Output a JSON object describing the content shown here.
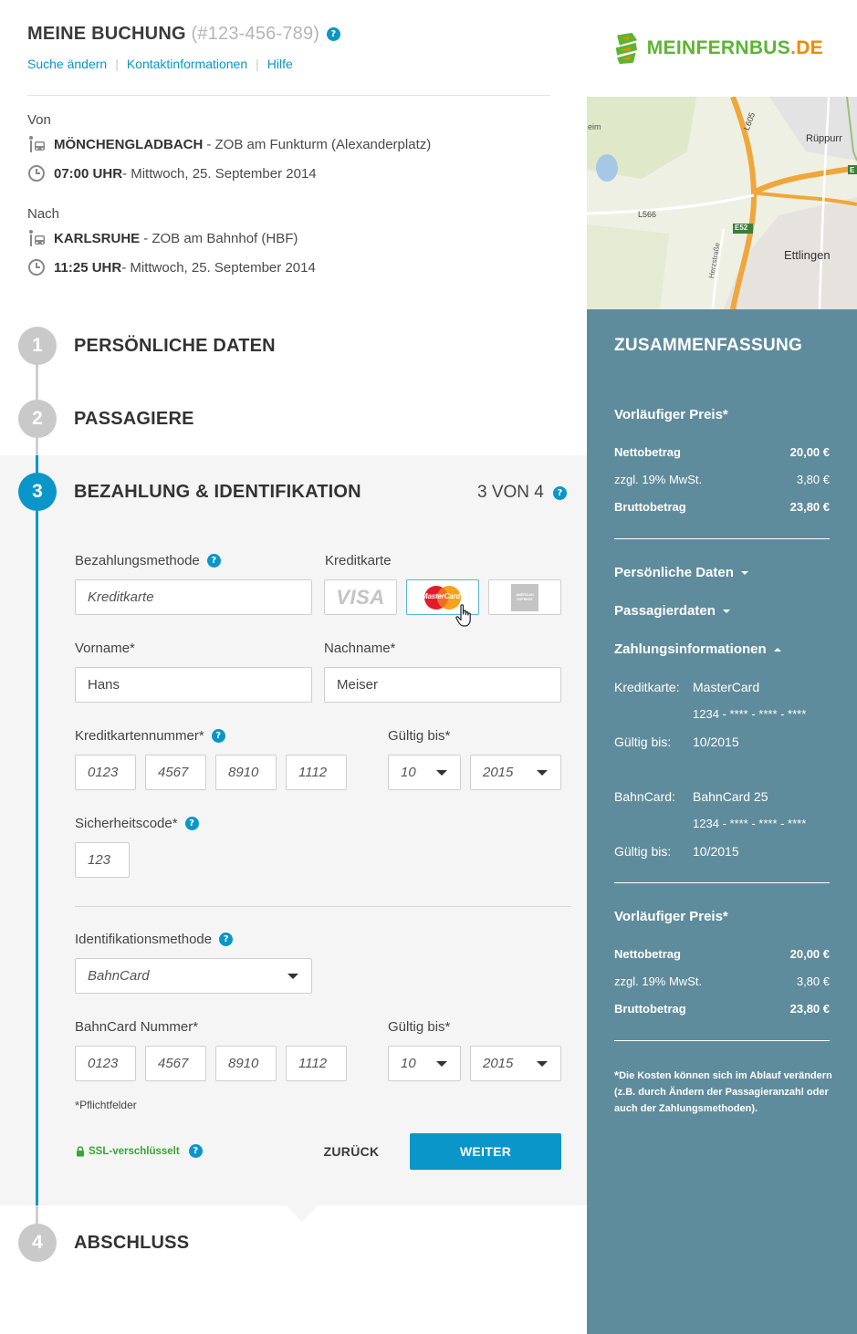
{
  "header": {
    "title": "MEINE BUCHUNG",
    "booking_number": "(#123-456-789)",
    "help_icon": "question-icon",
    "links": [
      "Suche ändern",
      "Kontaktinformationen",
      "Hilfe"
    ]
  },
  "logo": {
    "text_main": "MEINFERNBUS",
    "text_tld": ".DE",
    "colors": {
      "green": "#5cb531",
      "orange": "#f08a00"
    }
  },
  "route": {
    "from": {
      "label": "Von",
      "city": "MÖNCHENGLADBACH",
      "station": "- ZOB am Funkturm (Alexanderplatz)",
      "time": "07:00 UHR",
      "date": "- Mittwoch, 25. September 2014"
    },
    "to": {
      "label": "Nach",
      "city": "KARLSRUHE",
      "station": "- ZOB am Bahnhof (HBF)",
      "time": "11:25 UHR",
      "date": "- Mittwoch, 25. September 2014"
    }
  },
  "steps": [
    {
      "number": "1",
      "title": "PERSÖNLICHE DATEN"
    },
    {
      "number": "2",
      "title": "PASSAGIERE"
    },
    {
      "number": "3",
      "title": "BEZAHLUNG & IDENTIFIKATION",
      "progress": "3 VON 4"
    },
    {
      "number": "4",
      "title": "ABSCHLUSS"
    }
  ],
  "payment": {
    "method_label": "Bezahlungsmethode",
    "method_value": "Kreditkarte",
    "card_label": "Kreditkarte",
    "cards": [
      "VISA",
      "MasterCard",
      "AMERICAN EXPRESS"
    ],
    "selected_card": "MasterCard",
    "first_name_label": "Vorname*",
    "first_name": "Hans",
    "last_name_label": "Nachname*",
    "last_name": "Meiser",
    "cc_number_label": "Kreditkartennummer*",
    "cc_number": [
      "0123",
      "4567",
      "8910",
      "1112"
    ],
    "valid_label": "Gültig bis*",
    "valid_month": "10",
    "valid_year": "2015",
    "cvc_label": "Sicherheitscode*",
    "cvc": "123"
  },
  "identification": {
    "method_label": "Identifikationsmethode",
    "method_value": "BahnCard",
    "number_label": "BahnCard Nummer*",
    "number": [
      "0123",
      "4567",
      "8910",
      "1112"
    ],
    "valid_label": "Gültig bis*",
    "valid_month": "10",
    "valid_year": "2015"
  },
  "form_footer": {
    "required_note": "Pflichtfelder",
    "required_star": "*",
    "ssl": "SSL-verschlüsselt",
    "back": "ZURÜCK",
    "next": "WEITER"
  },
  "map_labels": {
    "ruppurr": "Rüppurr",
    "ettlingen": "Ettlingen",
    "l566": "L566",
    "e52": "E52",
    "l605": "L605",
    "herz": "Herzstraße",
    "heim": "eim",
    "e_edge": "E"
  },
  "summary": {
    "title": "ZUSAMMENFASSUNG",
    "price_title": "Vorläufiger Preis*",
    "net_label": "Nettobetrag",
    "net_value": "20,00 €",
    "vat_label": "zzgl. 19% MwSt.",
    "vat_value": "3,80 €",
    "gross_label": "Bruttobetrag",
    "gross_value": "23,80 €",
    "toggles": [
      "Persönliche Daten",
      "Passagierdaten",
      "Zahlungsinformationen"
    ],
    "payment_info": {
      "card_label": "Kreditkarte:",
      "card_value": "MasterCard",
      "card_number": "1234 - **** - **** - ****",
      "card_valid_label": "Gültig bis:",
      "card_valid": "10/2015",
      "bahncard_label": "BahnCard:",
      "bahncard_value": "BahnCard 25",
      "bahncard_number": "1234 - **** - **** - ****",
      "bahncard_valid_label": "Gültig bis:",
      "bahncard_valid": "10/2015"
    },
    "note_star": "*",
    "note": "Die Kosten können sich im Ablauf verändern (z.B. durch Ändern der Passagieranzahl oder auch der Zahlungsmethoden)."
  },
  "colors": {
    "accent": "#0a96c8",
    "sidebar": "#5f8c9c",
    "ssl_green": "#3aa635",
    "step_inactive": "#c9c9c9"
  }
}
